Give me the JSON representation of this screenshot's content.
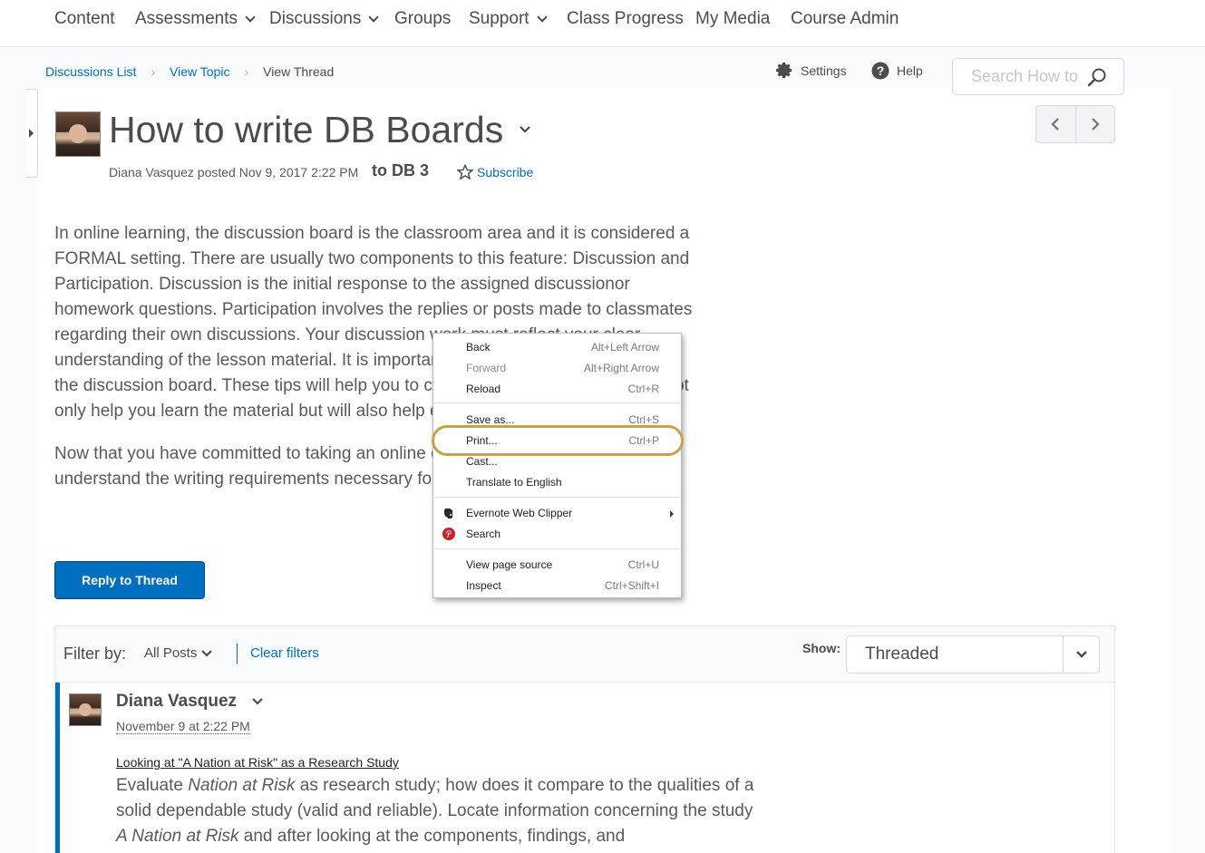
{
  "nav": {
    "items": [
      {
        "label": "Content",
        "dropdown": false
      },
      {
        "label": "Assessments",
        "dropdown": true
      },
      {
        "label": "Discussions",
        "dropdown": true
      },
      {
        "label": "Groups",
        "dropdown": false
      },
      {
        "label": "Support",
        "dropdown": true
      },
      {
        "label": "Class Progress",
        "dropdown": false
      },
      {
        "label": "My Media",
        "dropdown": false
      },
      {
        "label": "Course Admin",
        "dropdown": false
      }
    ]
  },
  "breadcrumb": {
    "items": [
      "Discussions List",
      "View Topic"
    ],
    "current": "View Thread"
  },
  "tools": {
    "settings": "Settings",
    "help": "Help",
    "search_placeholder": "Search How to"
  },
  "thread": {
    "title": "How to write DB Boards",
    "meta": "Diana Vasquez posted Nov 9, 2017 2:22 PM",
    "topic": "to DB 3",
    "subscribe": "Subscribe",
    "paragraphs": [
      "In online learning, the discussion board is the classroom area and it is considered a FORMAL setting. There are usually two components to this feature: Discussion and Participation.  Discussion is the initial response to the assigned discussionor homework questions.  Participation involves the replies or posts made to classmates regarding their own discussions.  Your discussion work must reflect your clear understanding of the lesson material. It is important to put forth your best work on the discussion board. These tips will help you to create discussion work that will not only help you learn the material but will also help ensure solid discussion scores.",
      "Now that you have committed to taking an online course, it is important to understand the writing requirements necessary for the discussion boards."
    ],
    "reply_button": "Reply to Thread"
  },
  "filter": {
    "label": "Filter by:",
    "value": "All Posts",
    "clear": "Clear filters",
    "show_label": "Show:",
    "show_value": "Threaded"
  },
  "post": {
    "author": "Diana Vasquez",
    "date": "November 9 at 2:22 PM",
    "link": "Looking at \"A Nation at Risk\" as a Research Study",
    "text_parts": [
      "Evaluate ",
      "Nation at Risk",
      " as research study; how does it compare to the qualities of a solid dependable study (valid and reliable). Locate information concerning the study ",
      "A Nation at Risk",
      " and after looking at the components, findings, and"
    ]
  },
  "context_menu": {
    "items": [
      {
        "label": "Back",
        "shortcut": "Alt+Left Arrow",
        "disabled": false
      },
      {
        "label": "Forward",
        "shortcut": "Alt+Right Arrow",
        "disabled": true
      },
      {
        "label": "Reload",
        "shortcut": "Ctrl+R",
        "disabled": false
      },
      {
        "label": "Save as...",
        "shortcut": "Ctrl+S",
        "disabled": false
      },
      {
        "label": "Print...",
        "shortcut": "Ctrl+P",
        "disabled": false,
        "highlighted": true
      },
      {
        "label": "Cast...",
        "shortcut": "",
        "disabled": false
      },
      {
        "label": "Translate to English",
        "shortcut": "",
        "disabled": false
      },
      {
        "label": "Evernote Web Clipper",
        "shortcut": "",
        "icon": "evernote-icon",
        "submenu": true
      },
      {
        "label": "Search",
        "shortcut": "",
        "icon": "pinterest-icon"
      },
      {
        "label": "View page source",
        "shortcut": "Ctrl+U",
        "disabled": false
      },
      {
        "label": "Inspect",
        "shortcut": "Ctrl+Shift+I",
        "disabled": false
      }
    ],
    "highlight_color": "#c8a24a"
  },
  "colors": {
    "link": "#006fbf",
    "primary_button": "#006fbf",
    "text": "#565a5c"
  }
}
